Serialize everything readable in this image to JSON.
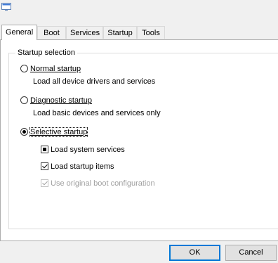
{
  "window": {
    "icon": "msconfig-app-icon"
  },
  "tabs": [
    {
      "label": "General",
      "active": true
    },
    {
      "label": "Boot"
    },
    {
      "label": "Services"
    },
    {
      "label": "Startup"
    },
    {
      "label": "Tools"
    }
  ],
  "general": {
    "group_title": "Startup selection",
    "normal": {
      "label": "Normal startup",
      "description": "Load all device drivers and services",
      "selected": false
    },
    "diagnostic": {
      "label": "Diagnostic startup",
      "description": "Load basic devices and services only",
      "selected": false
    },
    "selective": {
      "label": "Selective startup",
      "selected": true
    },
    "options": {
      "system_services": {
        "label": "Load system services",
        "state": "indeterminate"
      },
      "startup_items": {
        "label": "Load startup items",
        "state": "checked"
      },
      "boot_config": {
        "label": "Use original boot configuration",
        "state": "checked",
        "disabled": true
      }
    }
  },
  "buttons": {
    "ok": "OK",
    "cancel": "Cancel"
  },
  "colors": {
    "accent": "#0078d7",
    "disabled_text": "#a0a0a0"
  }
}
